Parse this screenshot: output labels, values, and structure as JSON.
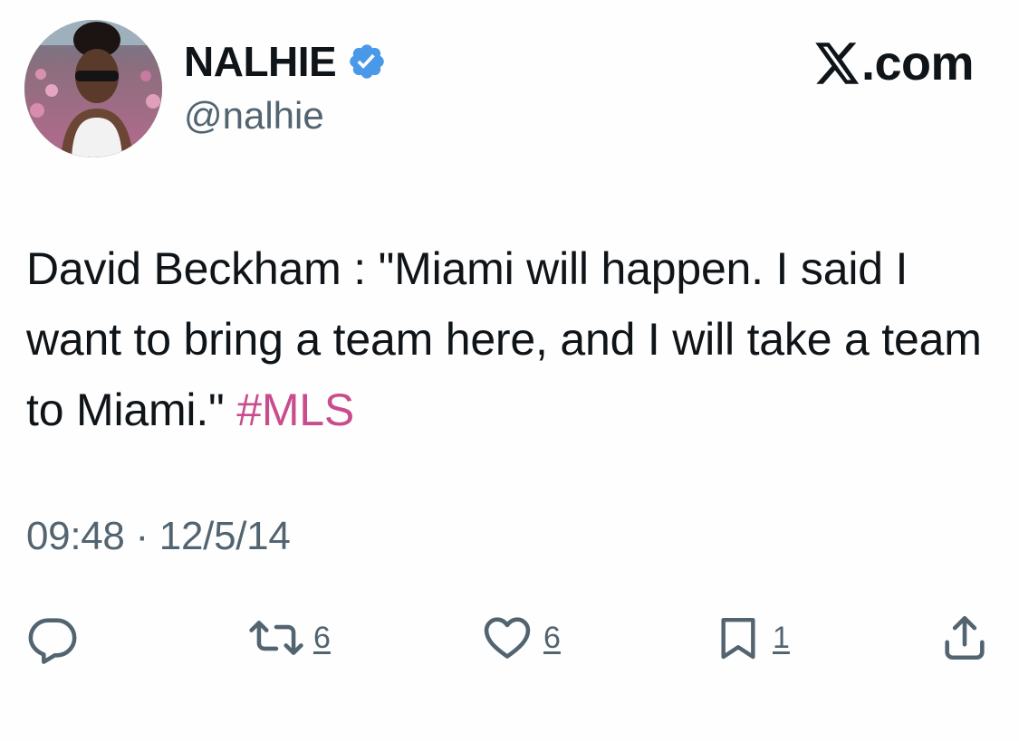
{
  "author": {
    "display_name": "NALHIE",
    "handle": "@nalhie",
    "verified": true,
    "verified_color": "#4a99e9"
  },
  "brand": {
    "logo_icon": "x-logo-icon",
    "label": ".com"
  },
  "tweet": {
    "text": "David Beckham : \"Miami will happen. I said I want to bring a team here, and I will take a team to Miami.\" ",
    "hashtag": "#MLS",
    "hashtag_color": "#c94c8d",
    "timestamp": "09:48 · 12/5/14"
  },
  "actions": {
    "reply": {
      "icon": "reply-icon",
      "count": ""
    },
    "repost": {
      "icon": "repost-icon",
      "count": "6"
    },
    "like": {
      "icon": "heart-icon",
      "count": "6"
    },
    "bookmark": {
      "icon": "bookmark-icon",
      "count": "1"
    },
    "share": {
      "icon": "share-icon"
    }
  }
}
